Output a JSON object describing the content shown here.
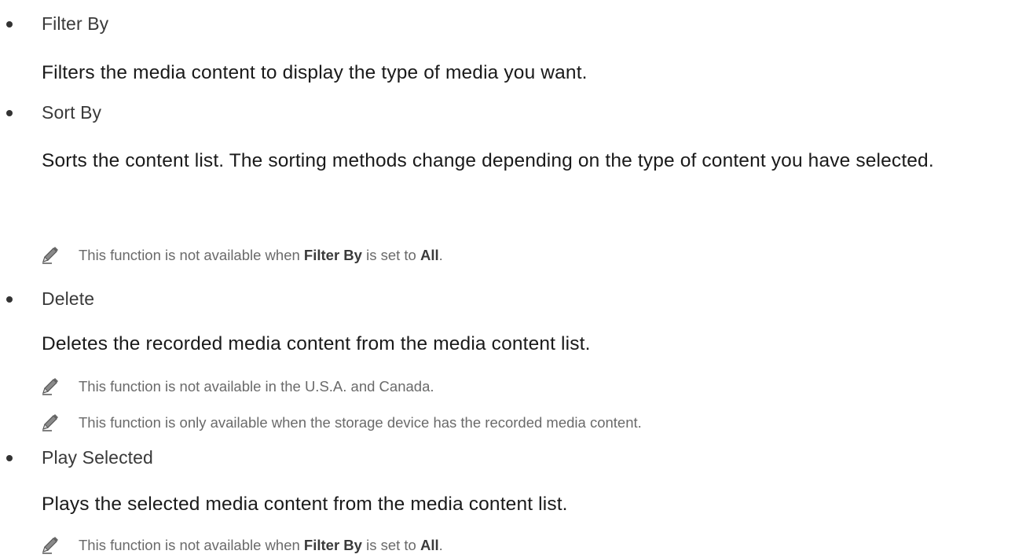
{
  "items": [
    {
      "term": "Filter By",
      "description": "Filters the media content to display the type of media you want.",
      "notes": []
    },
    {
      "term": "Sort By",
      "description": "Sorts the content list. The sorting methods change depending on the type of content you have selected.",
      "notes": [
        {
          "icon": "pencil-note-icon",
          "before": "This function is not available when ",
          "bold1": "Filter By",
          "middle": " is set to ",
          "bold2": "All",
          "after": "."
        }
      ]
    },
    {
      "term": "Delete",
      "description": "Deletes the recorded media content from the media content list.",
      "notes": [
        {
          "icon": "pencil-note-icon",
          "text": "This function is not available in the U.S.A. and Canada."
        },
        {
          "icon": "pencil-note-icon",
          "text": "This function is only available when the storage device has the recorded media content."
        }
      ]
    },
    {
      "term": "Play Selected",
      "description": "Plays the selected media content from the media content list.",
      "notes": [
        {
          "icon": "pencil-note-icon",
          "before": "This function is not available when ",
          "bold1": "Filter By",
          "middle": " is set to ",
          "bold2": "All",
          "after": "."
        }
      ]
    }
  ]
}
